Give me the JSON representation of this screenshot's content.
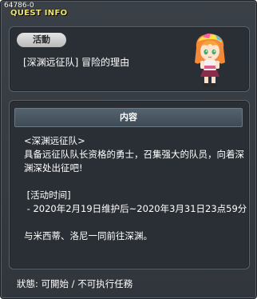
{
  "window": {
    "id_label": "64786-0",
    "title": "QUEST INFO"
  },
  "event": {
    "badge": "活動",
    "title": "[深渊远征队] 冒险的理由"
  },
  "content": {
    "header": "内容",
    "lines": [
      "<深渊远征队>",
      "具备远征队队长资格的勇士，召集强大的队员，向着深渊深处出征吧!",
      "",
      " [活动时间]",
      " - 2020年2月19日维护后~2020年3月31日23点59分",
      "",
      "与米西蒂、洛尼一同前往深渊。"
    ]
  },
  "status": {
    "text": "狀態: 可開始 / 不可执行任務"
  },
  "colors": {
    "title": "#f0e56c",
    "panel_bg": "#2a2f35",
    "window_bg": "#3a4047"
  }
}
